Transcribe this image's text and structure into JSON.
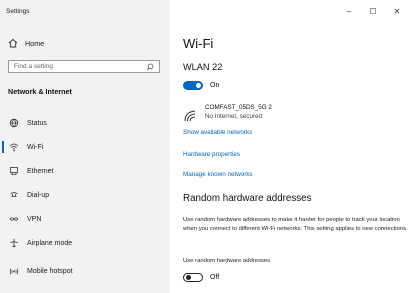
{
  "window": {
    "title": "Settings",
    "controls": {
      "minimize": "–",
      "maximize": "☐",
      "close": "✕"
    }
  },
  "sidebar": {
    "home_label": "Home",
    "search_placeholder": "Find a setting",
    "section_title": "Network & Internet",
    "items": [
      {
        "label": "Status",
        "icon": "status-globe-icon"
      },
      {
        "label": "Wi-Fi",
        "icon": "wifi-icon",
        "active": true
      },
      {
        "label": "Ethernet",
        "icon": "ethernet-icon"
      },
      {
        "label": "Dial-up",
        "icon": "dialup-icon"
      },
      {
        "label": "VPN",
        "icon": "vpn-icon"
      },
      {
        "label": "Airplane mode",
        "icon": "airplane-icon"
      },
      {
        "label": "Mobile hotspot",
        "icon": "hotspot-icon"
      }
    ]
  },
  "main": {
    "page_title": "Wi-Fi",
    "wlan_title": "WLAN 22",
    "wlan_toggle": {
      "state": "On"
    },
    "network": {
      "name": "COMFAST_05DS_5G 2",
      "status": "No Internet, secured"
    },
    "links": {
      "show_available": "Show available networks",
      "hardware_properties": "Hardware properties",
      "manage_known": "Manage known networks"
    },
    "random_section": {
      "title": "Random hardware addresses",
      "description": "Use random hardware addresses to make it harder for people to track your location when you connect to different Wi-Fi networks. This setting applies to new connections.",
      "toggle_label": "Use random hardware addresses",
      "toggle_state": "Off"
    }
  },
  "colors": {
    "accent": "#0067c0",
    "sidebar_bg": "#f2f2f2"
  }
}
